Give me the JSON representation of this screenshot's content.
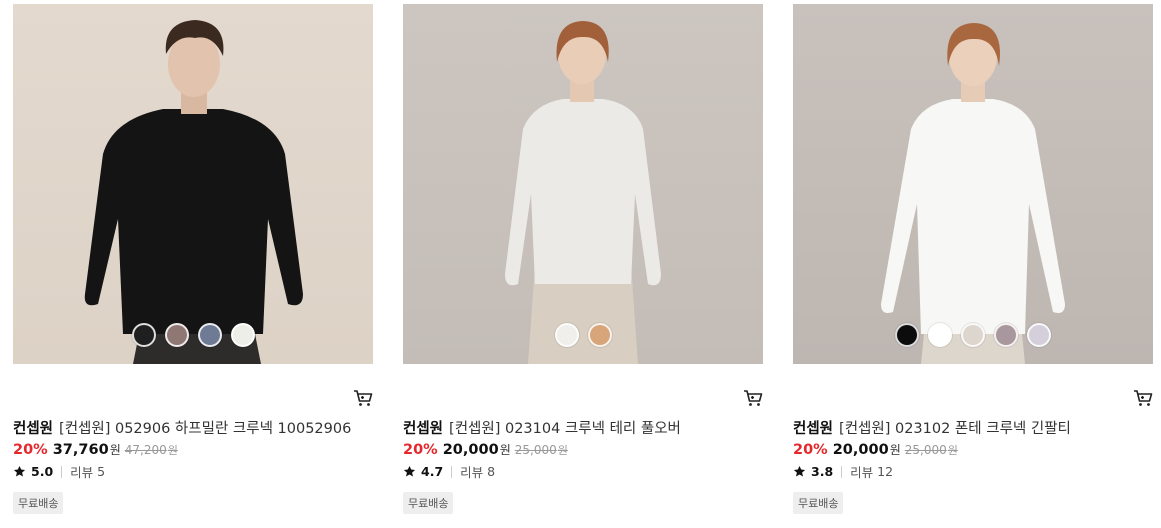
{
  "products": [
    {
      "brand": "컨셉원",
      "name": "[컨셉원] 052906 하프밀란 크루넥 10052906",
      "discount": "20%",
      "price": "37,760",
      "currency": "원",
      "original_price": "47,200",
      "original_currency": "원",
      "rating": "5.0",
      "review_label": "리뷰",
      "review_count": "5",
      "badge": "무료배송",
      "garment_color": "#141414",
      "swatches": [
        "#1e1f1e",
        "#8f7873",
        "#6f7a95",
        "#eeeee9"
      ]
    },
    {
      "brand": "컨셉원",
      "name": "[컨셉원] 023104 크루넥 테리 풀오버",
      "discount": "20%",
      "price": "20,000",
      "currency": "원",
      "original_price": "25,000",
      "original_currency": "원",
      "rating": "4.7",
      "review_label": "리뷰",
      "review_count": "8",
      "badge": "무료배송",
      "garment_color": "#eceae6",
      "swatches": [
        "#f0efeb",
        "#d8a47a"
      ]
    },
    {
      "brand": "컨셉원",
      "name": "[컨셉원] 023102 폰테 크루넥 긴팔티",
      "discount": "20%",
      "price": "20,000",
      "currency": "원",
      "original_price": "25,000",
      "original_currency": "원",
      "rating": "3.8",
      "review_label": "리뷰",
      "review_count": "12",
      "badge": "무료배송",
      "garment_color": "#f7f7f5",
      "swatches": [
        "#0c0c0c",
        "#ffffff",
        "#ddd6cf",
        "#a8979c",
        "#d4cfdb"
      ]
    }
  ],
  "icons": {
    "cart": "shopping-cart-icon",
    "star": "star-icon"
  }
}
